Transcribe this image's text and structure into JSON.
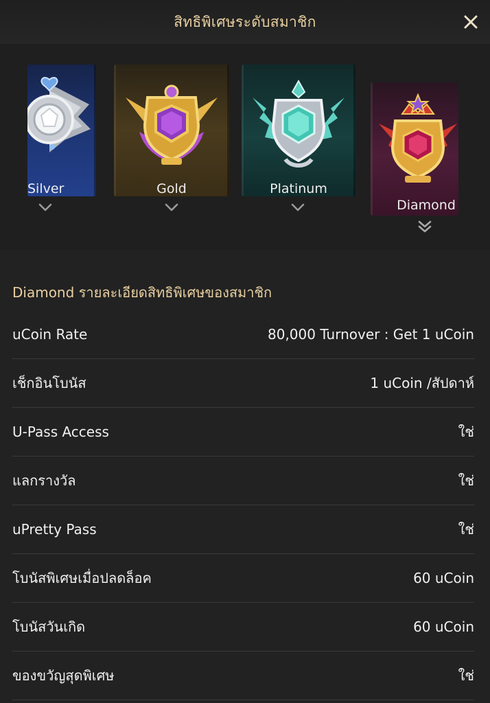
{
  "header": {
    "title": "สิทธิพิเศษระดับสมาชิก"
  },
  "tiers": [
    {
      "name": "Silver",
      "selected": false
    },
    {
      "name": "Gold",
      "selected": false
    },
    {
      "name": "Platinum",
      "selected": false
    },
    {
      "name": "Diamond",
      "selected": true
    }
  ],
  "details": {
    "title": "Diamond รายละเอียดสิทธิพิเศษของสมาชิก",
    "rows": [
      {
        "label": "uCoin Rate",
        "value": "80,000 Turnover : Get 1 uCoin"
      },
      {
        "label": "เช็กอินโบนัส",
        "value": "1 uCoin /สัปดาห์"
      },
      {
        "label": "U-Pass Access",
        "value": "ใช่"
      },
      {
        "label": "แลกรางวัล",
        "value": "ใช่"
      },
      {
        "label": "uPretty Pass",
        "value": "ใช่"
      },
      {
        "label": "โบนัสพิเศษเมื่อปลดล็อค",
        "value": "60 uCoin"
      },
      {
        "label": "โบนัสวันเกิด",
        "value": "60 uCoin"
      },
      {
        "label": "ของขวัญสุดพิเศษ",
        "value": "ใช่"
      }
    ]
  },
  "colors": {
    "accent": "#e8cfa0",
    "background": "#222222",
    "divider": "#3a3a3a"
  }
}
